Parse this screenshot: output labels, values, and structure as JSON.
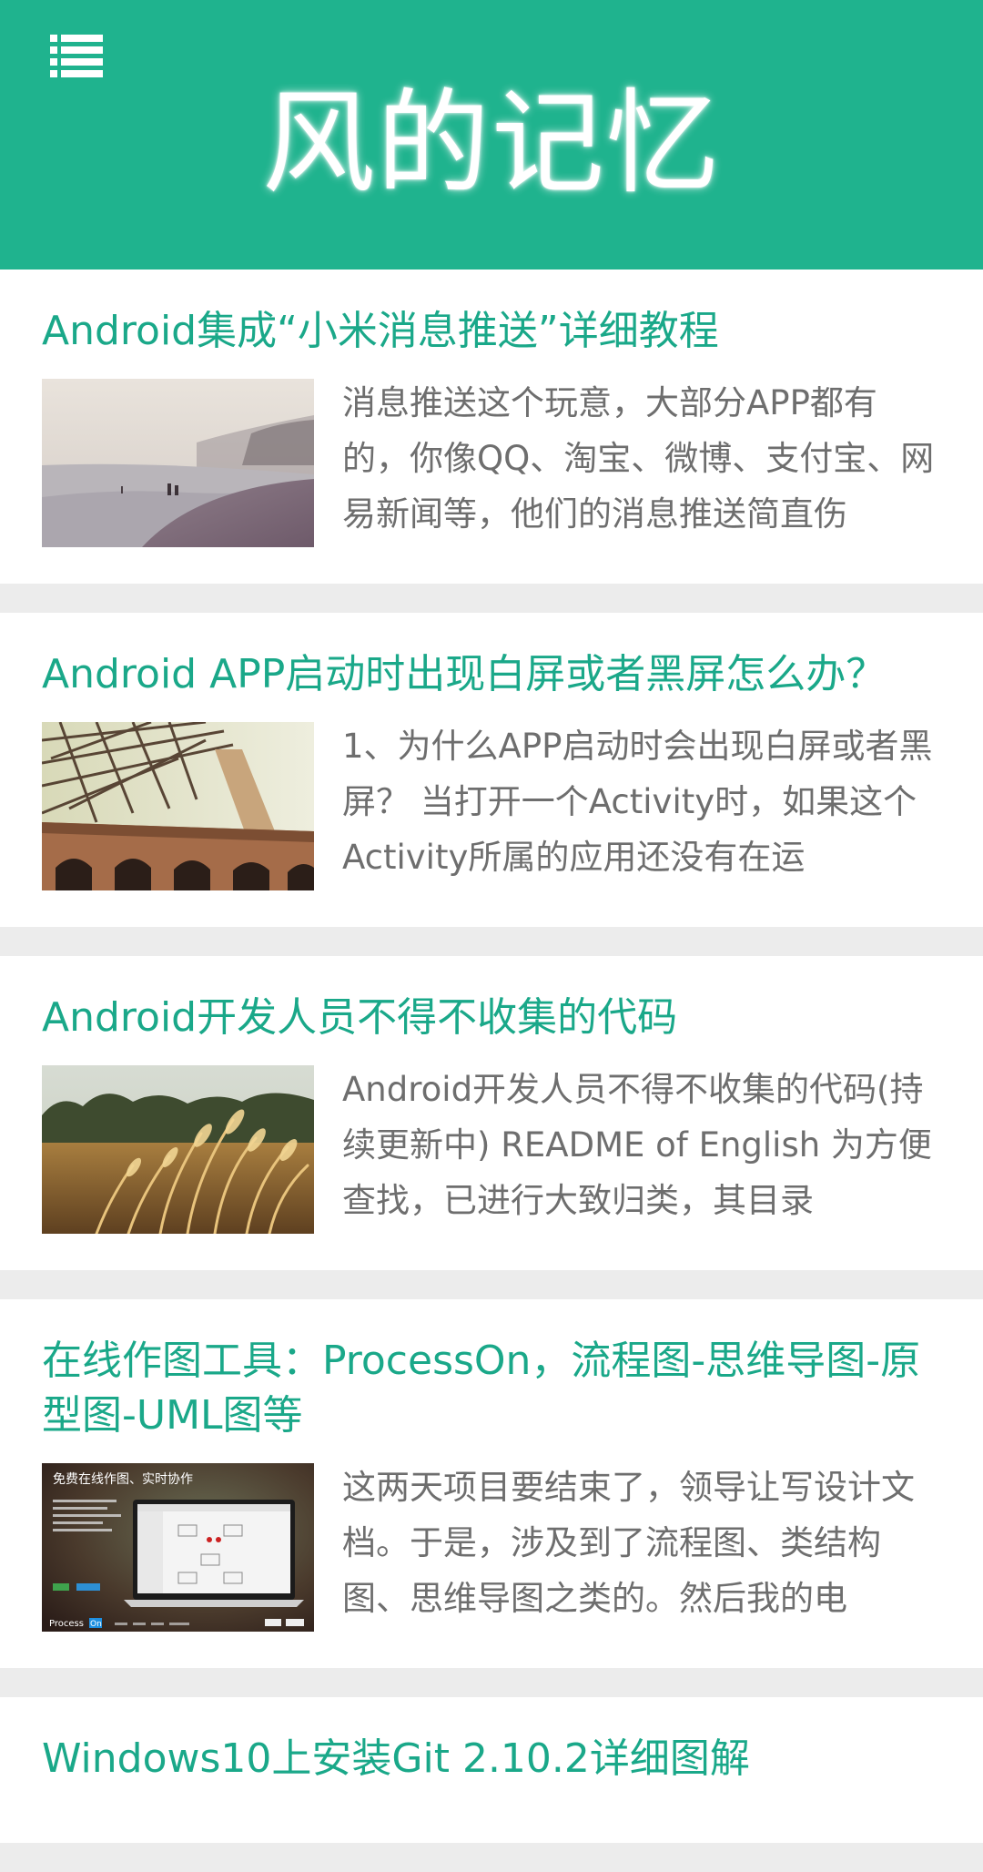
{
  "header": {
    "title": "风的记忆",
    "menu_icon": "list-menu-icon",
    "color": "#1fb38e"
  },
  "posts": [
    {
      "title": "Android集成“小米消息推送”详细教程",
      "excerpt": "消息推送这个玩意，大部分APP都有的，你像QQ、淘宝、微博、支付宝、网易新闻等，他们的消息推送简直伤",
      "thumbnail": "beach-image"
    },
    {
      "title": "Android APP启动时出现白屏或者黑屏怎么办？",
      "excerpt": "1、为什么APP启动时会出现白屏或者黑屏？ 当打开一个Activity时，如果这个Activity所属的应用还没有在运",
      "thumbnail": "bridge-image"
    },
    {
      "title": "Android开发人员不得不收集的代码",
      "excerpt": "Android开发人员不得不收集的代码(持续更新中) README of English 为方便查找，已进行大致归类，其目录",
      "thumbnail": "wheat-field-image"
    },
    {
      "title": "在线作图工具：ProcessOn，流程图-思维导图-原型图-UML图等",
      "excerpt": "这两天项目要结束了，领导让写设计文档。于是，涉及到了流程图、类结构图、思维导图之类的。然后我的电",
      "thumbnail": "processon-screenshot-image",
      "thumbnail_text": {
        "headline": "免费在线作图、实时协作",
        "brand_prefix": "Process",
        "brand_suffix": "On"
      }
    },
    {
      "title": "Windows10上安装Git 2.10.2详细图解",
      "excerpt": "",
      "thumbnail": ""
    }
  ]
}
